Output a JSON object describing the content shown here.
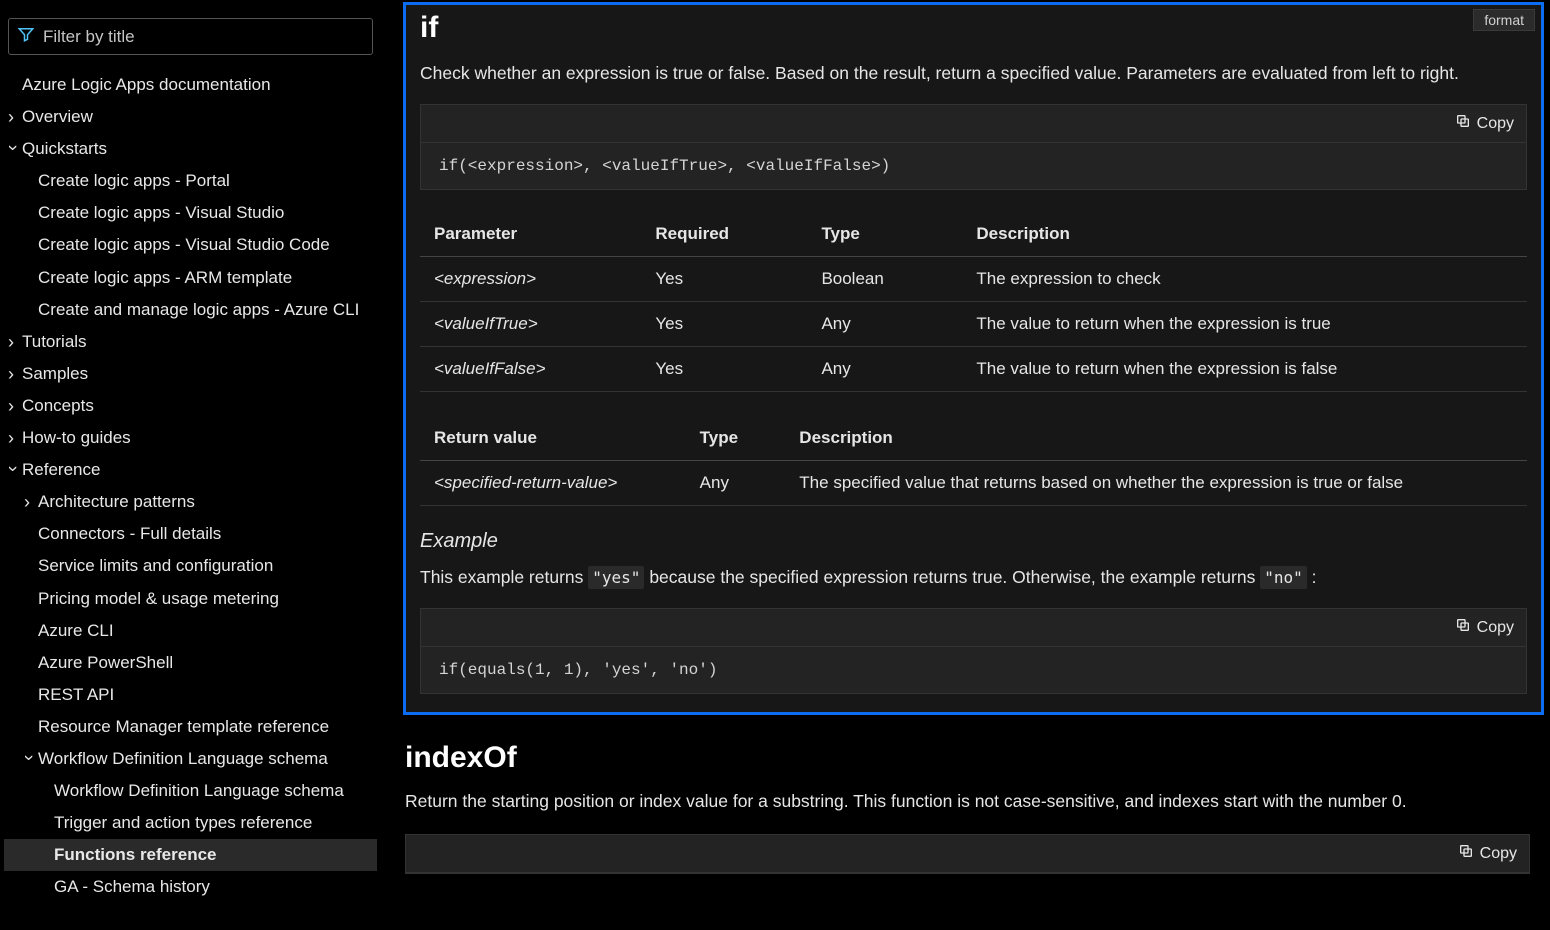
{
  "sidebar": {
    "filter_placeholder": "Filter by title",
    "root": "Azure Logic Apps documentation",
    "overview": "Overview",
    "quickstarts": "Quickstarts",
    "quickstarts_items": [
      "Create logic apps - Portal",
      "Create logic apps - Visual Studio",
      "Create logic apps - Visual Studio Code",
      "Create logic apps - ARM template",
      "Create and manage logic apps - Azure CLI"
    ],
    "tutorials": "Tutorials",
    "samples": "Samples",
    "concepts": "Concepts",
    "howto": "How-to guides",
    "reference": "Reference",
    "reference_items": {
      "arch": "Architecture patterns",
      "connectors": "Connectors - Full details",
      "limits": "Service limits and configuration",
      "pricing": "Pricing model & usage metering",
      "cli": "Azure CLI",
      "ps": "Azure PowerShell",
      "rest": "REST API",
      "rmtr": "Resource Manager template reference",
      "wdls": "Workflow Definition Language schema",
      "wdls_items": [
        "Workflow Definition Language schema",
        "Trigger and action types reference",
        "Functions reference",
        "GA - Schema history"
      ]
    }
  },
  "ifSection": {
    "format_label": "format",
    "title": "if",
    "desc": "Check whether an expression is true or false. Based on the result, return a specified value. Parameters are evaluated from left to right.",
    "copy_label": "Copy",
    "code1": "if(<expression>, <valueIfTrue>, <valueIfFalse>)",
    "param_header": [
      "Parameter",
      "Required",
      "Type",
      "Description"
    ],
    "param_rows": [
      [
        "<expression>",
        "Yes",
        "Boolean",
        "The expression to check"
      ],
      [
        "<valueIfTrue>",
        "Yes",
        "Any",
        "The value to return when the expression is true"
      ],
      [
        "<valueIfFalse>",
        "Yes",
        "Any",
        "The value to return when the expression is false"
      ]
    ],
    "return_header": [
      "Return value",
      "Type",
      "Description"
    ],
    "return_rows": [
      [
        "<specified-return-value>",
        "Any",
        "The specified value that returns based on whether the expression is true or false"
      ]
    ],
    "example_h": "Example",
    "example_pre": "This example returns ",
    "example_code_yes": "\"yes\"",
    "example_mid": " because the specified expression returns true. Otherwise, the example returns ",
    "example_code_no": "\"no\"",
    "example_post": " :",
    "code2": "if(equals(1, 1), 'yes', 'no')"
  },
  "indexOfSection": {
    "title": "indexOf",
    "desc": "Return the starting position or index value for a substring. This function is not case-sensitive, and indexes start with the number 0.",
    "copy_label": "Copy"
  }
}
